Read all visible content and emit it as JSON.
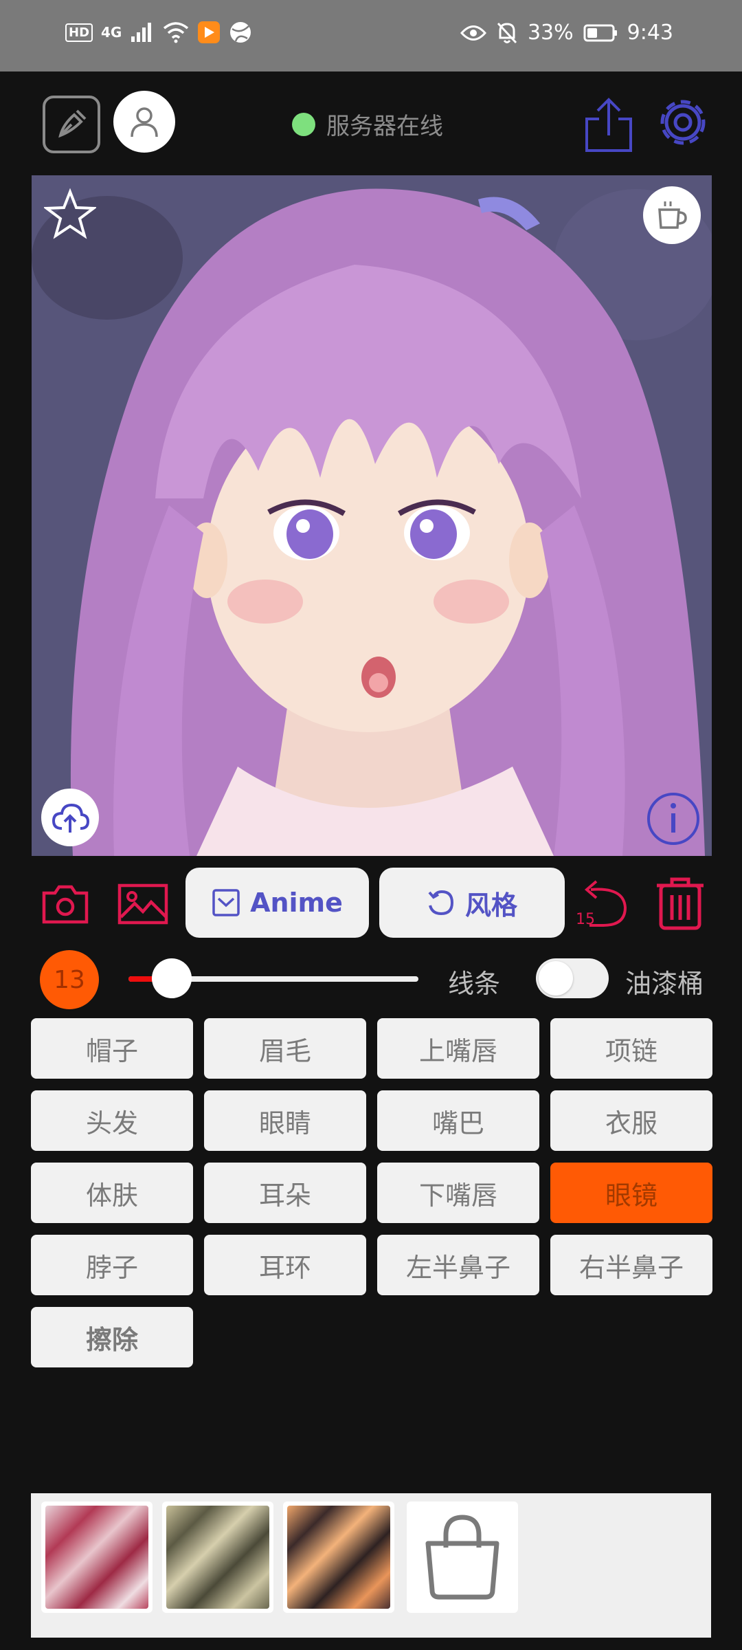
{
  "status_bar": {
    "hd": "HD",
    "network": "4G",
    "battery": "33%",
    "time": "9:43"
  },
  "top_bar": {
    "server_status": "服务器在线",
    "server_status_color": "#7ee07e"
  },
  "image": {
    "description_icons": [
      "star-icon",
      "coffee-icon",
      "cloud-upload-icon",
      "info-icon"
    ]
  },
  "tools": {
    "anime_label": "Anime",
    "style_label": "风格",
    "undo_count": "15"
  },
  "brush": {
    "size": "13",
    "slider_fraction": 0.15,
    "line_label": "线条",
    "bucket_label": "油漆桶",
    "bucket_enabled": false
  },
  "parts": [
    {
      "label": "帽子",
      "active": false
    },
    {
      "label": "眉毛",
      "active": false
    },
    {
      "label": "上嘴唇",
      "active": false
    },
    {
      "label": "项链",
      "active": false
    },
    {
      "label": "头发",
      "active": false
    },
    {
      "label": "眼睛",
      "active": false
    },
    {
      "label": "嘴巴",
      "active": false
    },
    {
      "label": "衣服",
      "active": false
    },
    {
      "label": "体肤",
      "active": false
    },
    {
      "label": "耳朵",
      "active": false
    },
    {
      "label": "下嘴唇",
      "active": false
    },
    {
      "label": "眼镜",
      "active": true
    },
    {
      "label": "脖子",
      "active": false
    },
    {
      "label": "耳环",
      "active": false
    },
    {
      "label": "左半鼻子",
      "active": false
    },
    {
      "label": "右半鼻子",
      "active": false
    },
    {
      "label": "擦除",
      "active": false
    }
  ],
  "colors": {
    "accent_orange": "#ff5a05",
    "accent_red": "#e0184f",
    "accent_blue": "#5353c5"
  },
  "palette": {
    "swatches": [
      "red-marble",
      "olive-marble",
      "orange-marble"
    ],
    "shop_icon": "shopping-bag-icon"
  }
}
